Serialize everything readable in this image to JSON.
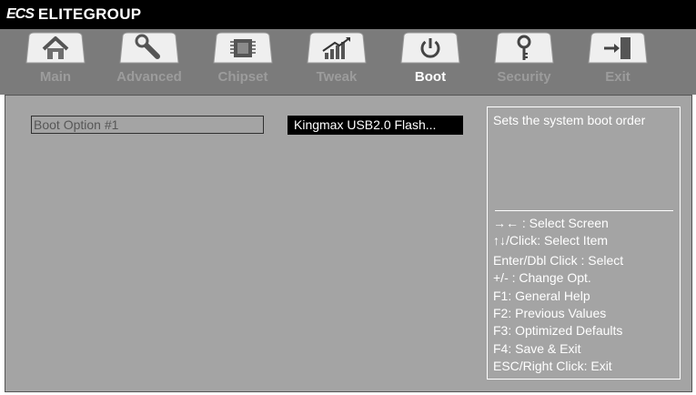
{
  "brand": {
    "logo": "ECS",
    "name": "ELITEGROUP"
  },
  "tabs": [
    {
      "label": "Main",
      "icon": "home-icon",
      "active": false
    },
    {
      "label": "Advanced",
      "icon": "wrench-icon",
      "active": false
    },
    {
      "label": "Chipset",
      "icon": "chip-icon",
      "active": false
    },
    {
      "label": "Tweak",
      "icon": "performance-chart-icon",
      "active": false
    },
    {
      "label": "Boot",
      "icon": "power-icon",
      "active": true
    },
    {
      "label": "Security",
      "icon": "key-icon",
      "active": false
    },
    {
      "label": "Exit",
      "icon": "exit-door-icon",
      "active": false
    }
  ],
  "boot_option": {
    "label": "Boot Option #1",
    "value": "Kingmax USB2.0 Flash..."
  },
  "help": {
    "description": "Sets the system boot order",
    "keys": [
      "→←  : Select Screen",
      "↑↓/Click: Select Item",
      "Enter/Dbl Click : Select",
      "+/- : Change Opt.",
      "F1: General Help",
      "F2: Previous Values",
      "F3: Optimized Defaults",
      "F4: Save & Exit",
      "ESC/Right Click: Exit"
    ]
  },
  "colors": {
    "titlebar": "#000000",
    "tabbar": "#7b7b7b",
    "content_bg": "#a4a4a4",
    "tab_label_inactive": "#9c9c9c",
    "tab_label_active": "#ffffff",
    "highlight_bg": "#000000",
    "help_text": "#ffffff"
  }
}
